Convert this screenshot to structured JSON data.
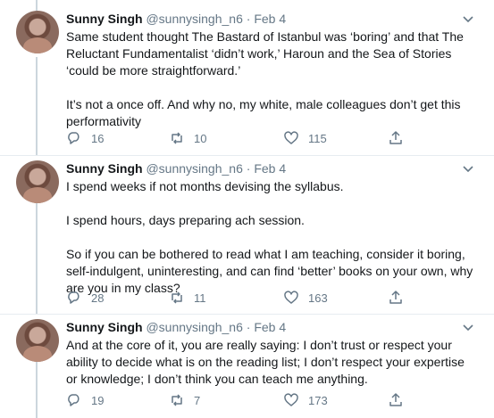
{
  "tweets": [
    {
      "name": "Sunny Singh",
      "handle": "@sunnysingh_n6",
      "dot": "·",
      "date": "Feb 4",
      "text": "Same student thought The Bastard of Istanbul was ‘boring’ and that The Reluctant Fundamentalist ‘didn’t work,’ Haroun and the Sea of Stories ‘could be more straightforward.’\n\nIt’s not a once off. And why no, my white, male colleagues don’t get this performativity",
      "replies": "16",
      "retweets": "10",
      "likes": "115"
    },
    {
      "name": "Sunny Singh",
      "handle": "@sunnysingh_n6",
      "dot": "·",
      "date": "Feb 4",
      "text": "I spend weeks if not months devising the syllabus.\n\nI spend hours, days preparing ach session.\n\nSo if you can be bothered to read what I am teaching, consider it boring, self-indulgent, uninteresting, and can find ‘better’ books on your own, why are you in my class?",
      "replies": "28",
      "retweets": "11",
      "likes": "163"
    },
    {
      "name": "Sunny Singh",
      "handle": "@sunnysingh_n6",
      "dot": "·",
      "date": "Feb 4",
      "text": "And at the core of it, you are really saying: I don’t trust or respect your ability to decide what is on the reading list; I don’t respect your expertise or knowledge; I don’t think you can teach me anything.",
      "replies": "19",
      "retweets": "7",
      "likes": "173"
    }
  ],
  "icons": {
    "reply": "reply-icon",
    "retweet": "retweet-icon",
    "like": "heart-icon",
    "share": "share-icon",
    "caret": "chevron-down-icon"
  },
  "colors": {
    "text": "#14171a",
    "muted": "#657786",
    "thread_line": "#ccd6dd",
    "divider": "#e6ecf0"
  }
}
